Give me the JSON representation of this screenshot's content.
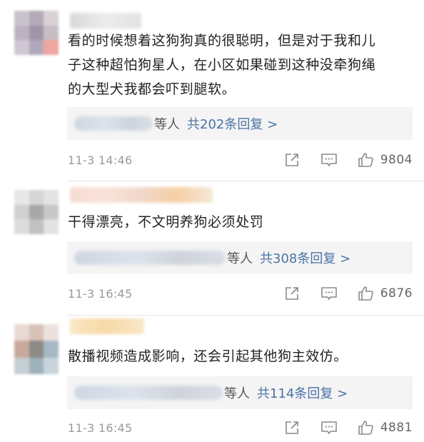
{
  "comments": [
    {
      "text_lines": [
        "看的时候想着这狗狗真的很聪明，但是对于我和儿",
        "子这种超怕狗星人，在小区如果碰到这种没牵狗绳",
        "的大型犬我都会吓到腿软。"
      ],
      "reply_suffix": "等人",
      "reply_count": "共202条回复 >",
      "time": "11-3 14:46",
      "likes": "9804"
    },
    {
      "text_lines": [
        "干得漂亮，不文明养狗必须处罚"
      ],
      "reply_suffix": "等人",
      "reply_count": "共308条回复 >",
      "time": "11-3 16:45",
      "likes": "6876"
    },
    {
      "text_lines": [
        "散播视频造成影响，还会引起其他狗主效仿。"
      ],
      "reply_suffix": "等人",
      "reply_count": "共114条回复 >",
      "time": "11-3 16:45",
      "likes": "4881"
    }
  ],
  "icons": {
    "share": "share-icon",
    "comment": "comment-icon",
    "like": "thumbs-up-icon"
  },
  "colors": {
    "link": "#4a73a6",
    "text": "#222222",
    "meta": "#9a9a9a",
    "reply_bg": "#f4f4f4"
  }
}
